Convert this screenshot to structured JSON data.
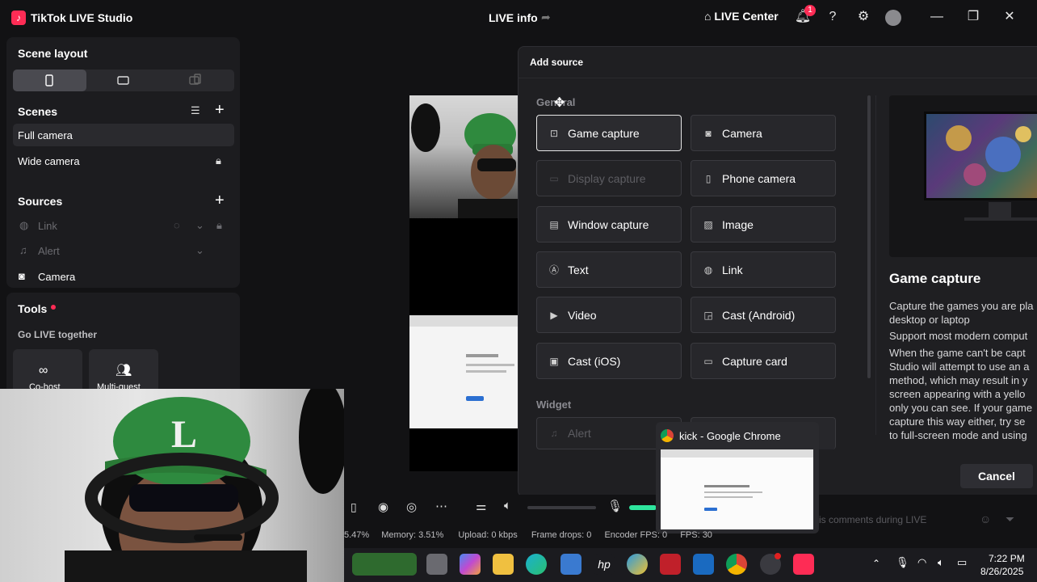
{
  "titlebar": {
    "logo_glyph": "♪",
    "app_title": "TikTok LIVE Studio",
    "live_info": "LIVE info",
    "live_center": "LIVE Center",
    "notif_count": "1"
  },
  "left_panel": {
    "scene_layout_title": "Scene layout",
    "scenes_title": "Scenes",
    "scenes": [
      "Full camera",
      "Wide camera"
    ],
    "sources_title": "Sources",
    "sources": [
      {
        "label": "Link",
        "dim": true
      },
      {
        "label": "Alert",
        "dim": true
      },
      {
        "label": "Camera",
        "dim": false
      }
    ],
    "tools_title": "Tools",
    "go_live_together": "Go LIVE together",
    "tools": [
      "Co-host",
      "Multi-guest"
    ]
  },
  "dialog": {
    "title": "Add source",
    "general_label": "General",
    "widget_label": "Widget",
    "buttons": [
      {
        "label": "Game capture",
        "icon": "gamepad-icon"
      },
      {
        "label": "Camera",
        "icon": "camera-icon"
      },
      {
        "label": "Display capture",
        "icon": "monitor-icon"
      },
      {
        "label": "Phone camera",
        "icon": "phone-camera-icon"
      },
      {
        "label": "Window capture",
        "icon": "window-icon"
      },
      {
        "label": "Image",
        "icon": "image-icon"
      },
      {
        "label": "Text",
        "icon": "text-icon"
      },
      {
        "label": "Link",
        "icon": "globe-icon"
      },
      {
        "label": "Video",
        "icon": "play-icon"
      },
      {
        "label": "Cast (Android)",
        "icon": "cast-icon"
      },
      {
        "label": "Cast (iOS)",
        "icon": "cast-ios-icon"
      },
      {
        "label": "Capture card",
        "icon": "capture-card-icon"
      }
    ],
    "widget_alert": "Alert",
    "preview_title": "Game capture",
    "desc_lines": [
      "Capture the games you are pla",
      "desktop or laptop",
      "Support most modern comput",
      "When the game can't be capt",
      "Studio will attempt to use an a",
      "method, which may result in y",
      "screen appearing with a yello",
      "only you can see. If your game",
      "capture this way either, try se",
      "to full-screen mode and using"
    ],
    "cancel_label": "Cancel"
  },
  "chrome_popup": {
    "title": "kick - Google Chrome"
  },
  "comment_placeholder": "is comments during LIVE",
  "stats": {
    "cpu": "5.47%",
    "memory": "Memory: 3.51%",
    "upload": "Upload: 0 kbps",
    "frame_drops": "Frame drops: 0",
    "encoder_fps": "Encoder FPS: 0",
    "fps": "FPS: 30"
  },
  "taskbar": {
    "time": "7:22 PM",
    "date": "8/26/2025"
  },
  "colors": {
    "accent": "#fe2c55",
    "mic_level": "#2ee59d"
  }
}
